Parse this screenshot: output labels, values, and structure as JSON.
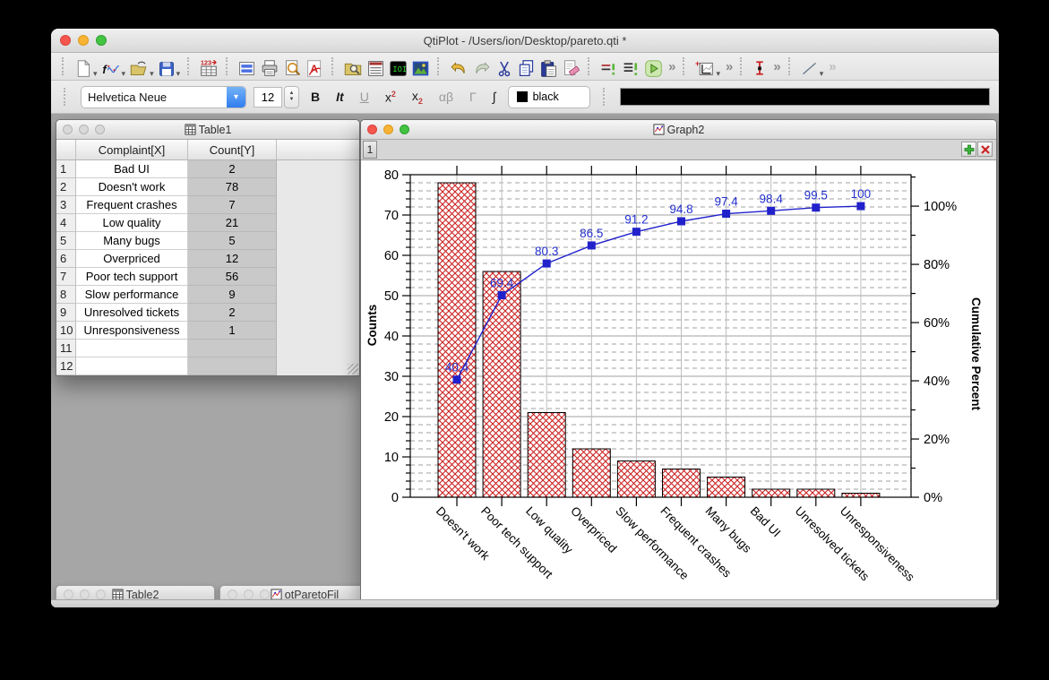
{
  "app": {
    "title": "QtiPlot - /Users/ion/Desktop/pareto.qti *"
  },
  "toolbar_main": {
    "overflow_label": "»",
    "icons": [
      "new-project",
      "new-function-plot",
      "open-project",
      "save-project",
      "import-ascii",
      "new-note",
      "print",
      "print-preview",
      "export-pdf",
      "project-explorer",
      "results-log",
      "script-console",
      "image-plot",
      "undo",
      "redo",
      "cut",
      "copy",
      "paste",
      "clear",
      "execute-line",
      "execute-all",
      "run-script",
      "plot-wizard",
      "error-bars",
      "draw-line"
    ]
  },
  "format_toolbar": {
    "font_name": "Helvetica Neue",
    "font_size": "12",
    "buttons": [
      {
        "label": "B"
      },
      {
        "label": "It"
      },
      {
        "label": "U"
      },
      {
        "main": "x",
        "sup": "2"
      },
      {
        "main": "x",
        "sub": "2"
      },
      {
        "label": "αβ"
      },
      {
        "label": "Γ"
      },
      {
        "label": "∫"
      }
    ],
    "color_name": "black"
  },
  "table1": {
    "title": "Table1",
    "columns": [
      "Complaint[X]",
      "Count[Y]"
    ],
    "rows": [
      {
        "n": "1",
        "complaint": "Bad UI",
        "count": "2"
      },
      {
        "n": "2",
        "complaint": "Doesn't work",
        "count": "78"
      },
      {
        "n": "3",
        "complaint": "Frequent crashes",
        "count": "7"
      },
      {
        "n": "4",
        "complaint": "Low quality",
        "count": "21"
      },
      {
        "n": "5",
        "complaint": "Many bugs",
        "count": "5"
      },
      {
        "n": "6",
        "complaint": "Overpriced",
        "count": "12"
      },
      {
        "n": "7",
        "complaint": "Poor tech support",
        "count": "56"
      },
      {
        "n": "8",
        "complaint": "Slow performance",
        "count": "9"
      },
      {
        "n": "9",
        "complaint": "Unresolved tickets",
        "count": "2"
      },
      {
        "n": "10",
        "complaint": "Unresponsiveness",
        "count": "1"
      },
      {
        "n": "11",
        "complaint": "",
        "count": ""
      },
      {
        "n": "12",
        "complaint": "",
        "count": ""
      }
    ]
  },
  "graph2": {
    "title": "Graph2",
    "layer_tab": "1",
    "chart_data": {
      "type": "bar",
      "categories": [
        "Doesn't work",
        "Poor tech support",
        "Low quality",
        "Overpriced",
        "Slow performance",
        "Frequent crashes",
        "Many bugs",
        "Bad UI",
        "Unresolved tickets",
        "Unresponsiveness"
      ],
      "series": [
        {
          "name": "Counts",
          "type": "bar",
          "values": [
            78,
            56,
            21,
            12,
            9,
            7,
            5,
            2,
            2,
            1
          ],
          "color": "#cc2222",
          "pattern": "crosshatch"
        },
        {
          "name": "Cumulative Percent",
          "type": "line",
          "values": [
            40.4,
            69.4,
            80.3,
            86.5,
            91.2,
            94.8,
            97.4,
            98.4,
            99.5,
            100
          ],
          "labels": [
            "40.4",
            "69.4",
            "80.3",
            "86.5",
            "91.2",
            "94.8",
            "97.4",
            "98.4",
            "99.5",
            "100"
          ],
          "color": "#2121cc",
          "marker": "square"
        }
      ],
      "left_axis": {
        "title": "Counts",
        "min": 0,
        "max": 80,
        "major_step": 10,
        "minor_step": 2,
        "tick_labels": [
          "0",
          "10",
          "20",
          "30",
          "40",
          "50",
          "60",
          "70",
          "80"
        ]
      },
      "right_axis": {
        "title": "Cumulative Percent",
        "min": 0,
        "max": 110.8,
        "major_step": 20,
        "minor_step": 10,
        "tick_labels": [
          "0%",
          "20%",
          "40%",
          "60%",
          "80%",
          "100%"
        ]
      },
      "grid": {
        "horizontal": true,
        "vertical": true,
        "minor_dashed": true
      },
      "label_color": "#2330cc"
    }
  },
  "minimized_windows": [
    {
      "label": "Table2"
    },
    {
      "label": "otParetoFil"
    }
  ]
}
